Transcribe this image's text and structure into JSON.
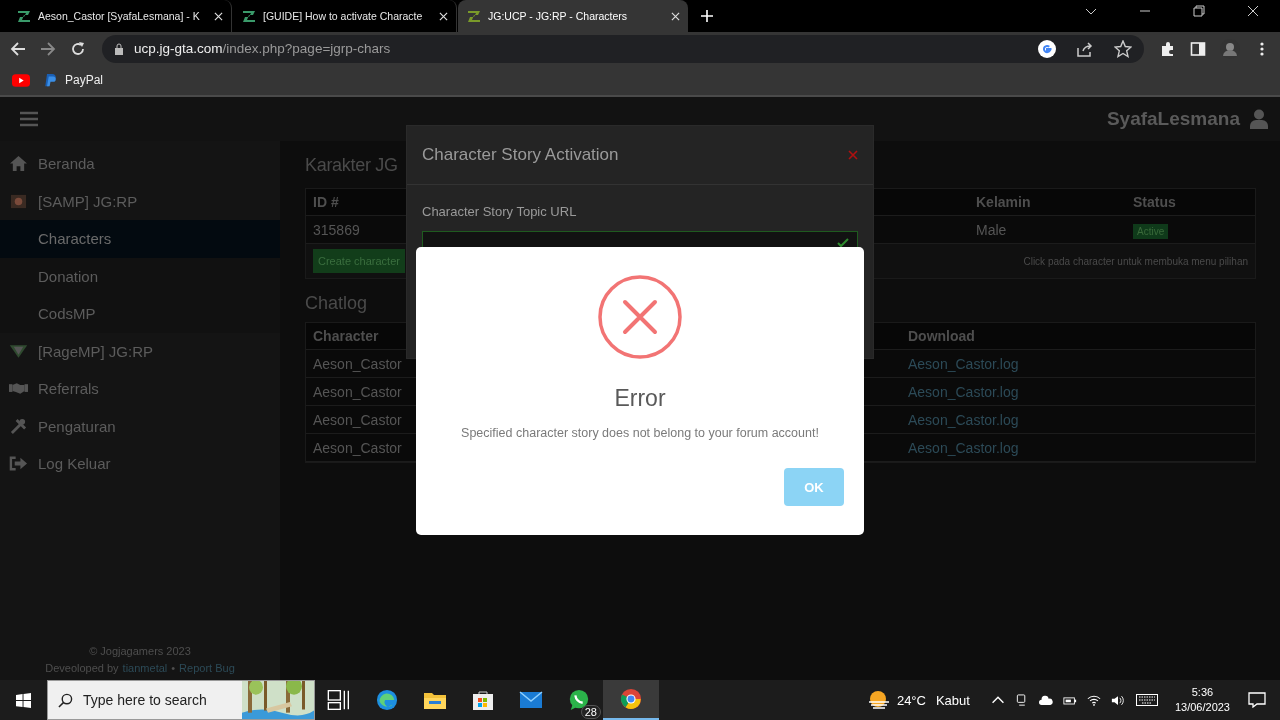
{
  "browser": {
    "tabs": [
      {
        "title": "Aeson_Castor [SyafaLesmana] - K",
        "selected": false
      },
      {
        "title": "[GUIDE] How to activate Characte",
        "selected": false
      },
      {
        "title": "JG:UCP - JG:RP - Characters",
        "selected": true
      }
    ],
    "address": {
      "host": "ucp.jg-gta.com",
      "path": "/index.php?page=jgrp-chars"
    },
    "bookmarks": [
      "PayPal"
    ]
  },
  "page": {
    "user": "SyafaLesmana",
    "sidebar": [
      {
        "label": "Beranda",
        "kind": "home",
        "selected": false
      },
      {
        "label": "[SAMP] JG:RP",
        "kind": "samp",
        "selected": false
      },
      {
        "label": "Characters",
        "kind": "sub",
        "selected": true
      },
      {
        "label": "Donation",
        "kind": "sub",
        "selected": false
      },
      {
        "label": "CodsMP",
        "kind": "sub",
        "selected": false
      },
      {
        "label": "[RageMP] JG:RP",
        "kind": "rage",
        "selected": false
      },
      {
        "label": "Referrals",
        "kind": "hands",
        "selected": false
      },
      {
        "label": "Pengaturan",
        "kind": "tools",
        "selected": false
      },
      {
        "label": "Log Keluar",
        "kind": "logout",
        "selected": false
      }
    ],
    "footer": {
      "copyright": "© Jogjagamers 2023",
      "prefix": "Deveoloped by",
      "author": "tianmetal",
      "separator": "•",
      "report": "Report Bug"
    },
    "title": "Karakter JG",
    "characters": {
      "columns": [
        "ID #",
        "Kelamin",
        "Status"
      ],
      "rows": [
        {
          "id": "315869",
          "gender": "Male",
          "status": "Active"
        }
      ],
      "create_button": "Create character",
      "hint": "Click pada character untuk membuka menu pilihan"
    },
    "chatlog": {
      "title": "Chatlog",
      "columns": [
        "Character",
        "Download"
      ],
      "rows": [
        {
          "character": "Aeson_Castor",
          "download": "Aeson_Castor.log"
        },
        {
          "character": "Aeson_Castor",
          "download": "Aeson_Castor.log"
        },
        {
          "character": "Aeson_Castor",
          "download": "Aeson_Castor.log"
        },
        {
          "character": "Aeson_Castor",
          "download": "Aeson_Castor.log"
        }
      ]
    }
  },
  "activation_modal": {
    "title": "Character Story Activation",
    "label": "Character Story Topic URL"
  },
  "error_dialog": {
    "title": "Error",
    "message": "Specified character story does not belong to your forum account!",
    "button": "OK"
  },
  "taskbar": {
    "search_placeholder": "Type here to search",
    "badge": "28",
    "temperature": "24°C",
    "weather": "Kabut",
    "time": "5:36",
    "date": "13/06/2023"
  }
}
